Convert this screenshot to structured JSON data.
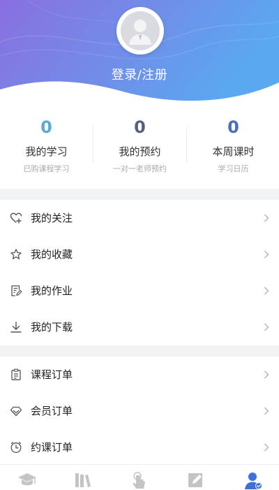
{
  "header": {
    "login_label": "登录/注册",
    "gradient_start": "#8a6fe0",
    "gradient_end": "#5aa8f0"
  },
  "stats": [
    {
      "value": "0",
      "label": "我的学习",
      "sub": "已购课程学习",
      "color": "#5aa9d6"
    },
    {
      "value": "0",
      "label": "我的预约",
      "sub": "一对一老师预约",
      "color": "#55607a"
    },
    {
      "value": "0",
      "label": "本周课时",
      "sub": "学习日历",
      "color": "#4a6fb8"
    }
  ],
  "menu_group_1": [
    {
      "label": "我的关注",
      "icon": "heart-plus-icon"
    },
    {
      "label": "我的收藏",
      "icon": "star-icon"
    },
    {
      "label": "我的作业",
      "icon": "homework-icon"
    },
    {
      "label": "我的下载",
      "icon": "download-icon"
    }
  ],
  "menu_group_2": [
    {
      "label": "课程订单",
      "icon": "clipboard-icon"
    },
    {
      "label": "会员订单",
      "icon": "diamond-icon"
    },
    {
      "label": "约课订单",
      "icon": "clock-icon"
    }
  ],
  "tabbar": {
    "tabs": [
      {
        "icon": "graduation-cap-icon",
        "active": false
      },
      {
        "icon": "books-icon",
        "active": false
      },
      {
        "icon": "touch-hand-icon",
        "active": false
      },
      {
        "icon": "edit-note-icon",
        "active": false
      },
      {
        "icon": "user-verified-icon",
        "active": true
      }
    ],
    "active_color": "#3f6fd8",
    "inactive_color": "#c4c4c4"
  }
}
